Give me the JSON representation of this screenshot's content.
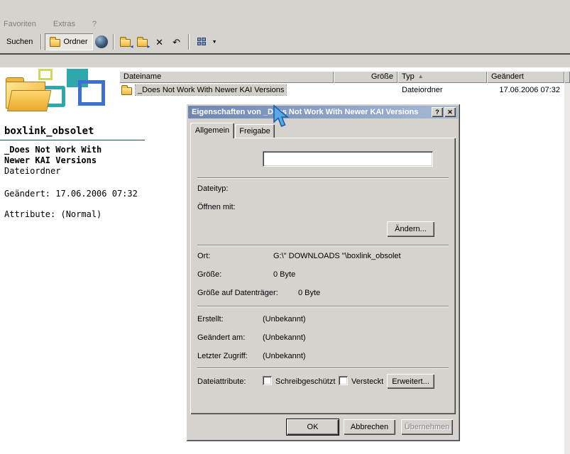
{
  "menubar": {
    "favoriten": "Favoriten",
    "extras": "Extras",
    "help": "?"
  },
  "toolbar": {
    "suchen_label": "Suchen",
    "ordner_label": "Ordner"
  },
  "icons": {
    "help_glyph": "?",
    "close_glyph": "✕",
    "delete_glyph": "✕",
    "undo_glyph": "↶",
    "sort_glyph": "▲",
    "dropdown_glyph": "▼",
    "move_arrow_glyph": "◂",
    "copy_arrow_glyph": "▸"
  },
  "list": {
    "columns": {
      "dateiname": "Dateiname",
      "groesse": "Größe",
      "typ": "Typ",
      "geaendert": "Geändert"
    },
    "row": {
      "name": "_Does Not Work With Newer KAI Versions",
      "groesse": "",
      "typ": "Dateiordner",
      "geaendert": "17.06.2006 07:32"
    }
  },
  "sidebar": {
    "title": "boxlink_obsolet",
    "name_line1": "_Does Not Work With",
    "name_line2": "Newer KAI Versions",
    "type": "Dateiordner",
    "modified": "Geändert: 17.06.2006 07:32",
    "attributes": "Attribute: (Normal)"
  },
  "dialog": {
    "title": "Eigenschaften von _Does Not Work With Newer KAI Versions",
    "tab_allgemein": "Allgemein",
    "tab_freigabe": "Freigabe",
    "name_field_value": "",
    "dateityp_label": "Dateityp:",
    "oeffnen_mit_label": "Öffnen mit:",
    "aendern_button": "Ändern...",
    "ort_label": "Ort:",
    "ort_value": "G:\\\" DOWNLOADS \"\\boxlink_obsolet",
    "groesse_label": "Größe:",
    "groesse_value": "0 Byte",
    "datentraeger_label": "Größe auf Datenträger:",
    "datentraeger_value": "0 Byte",
    "erstellt_label": "Erstellt:",
    "erstellt_value": "(Unbekannt)",
    "geaendert_label": "Geändert am:",
    "geaendert_value": "(Unbekannt)",
    "zugriff_label": "Letzter Zugriff:",
    "zugriff_value": "(Unbekannt)",
    "attribute_label": "Dateiattribute:",
    "cb_schreibgeschuetzt": "Schreibgeschützt",
    "cb_versteckt": "Versteckt",
    "erweitert_button": "Erweitert...",
    "ok_button": "OK",
    "abbrechen_button": "Abbrechen",
    "uebernehmen_button": "Übernehmen"
  },
  "colors": {
    "chrome": "#d6d3ce",
    "titlebar_left": "#6e86b4",
    "titlebar_right": "#a6b9d6",
    "selection": "#d4d0c8",
    "folder_yellow": "#f2b53d",
    "accent_teal": "#2fa8ad",
    "accent_blue": "#3f6fd0"
  }
}
